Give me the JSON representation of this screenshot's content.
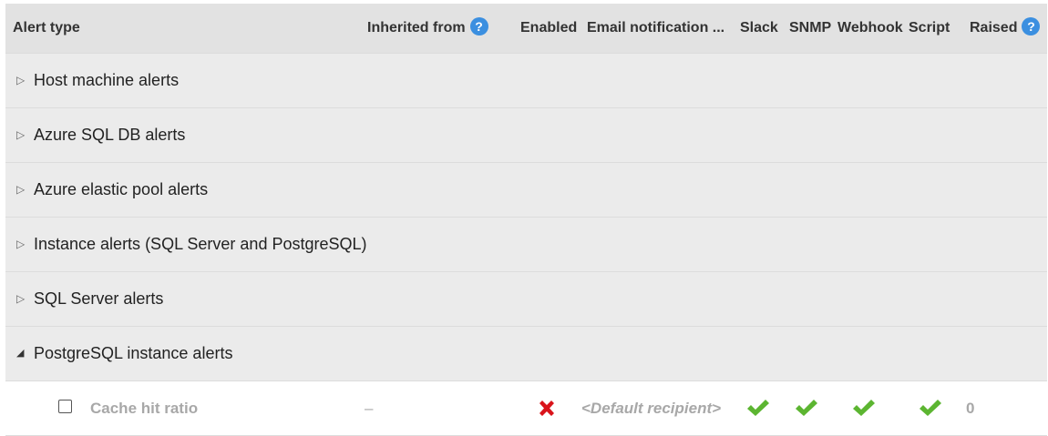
{
  "columns": {
    "alert_type": "Alert type",
    "inherited_from": "Inherited from",
    "enabled": "Enabled",
    "email": "Email notification ...",
    "slack": "Slack",
    "snmp": "SNMP",
    "webhook": "Webhook",
    "script": "Script",
    "raised": "Raised",
    "help_glyph": "?"
  },
  "groups": [
    {
      "label": "Host machine alerts",
      "expanded": false
    },
    {
      "label": "Azure SQL DB alerts",
      "expanded": false
    },
    {
      "label": "Azure elastic pool alerts",
      "expanded": false
    },
    {
      "label": "Instance alerts (SQL Server and PostgreSQL)",
      "expanded": false
    },
    {
      "label": "SQL Server alerts",
      "expanded": false
    },
    {
      "label": "PostgreSQL instance alerts",
      "expanded": true
    }
  ],
  "rows": [
    {
      "name": "Cache hit ratio",
      "inherited_from": "–",
      "enabled": false,
      "email": "<Default recipient>",
      "slack": true,
      "snmp": true,
      "webhook": true,
      "script": true,
      "raised": "0"
    }
  ],
  "colors": {
    "header_bg": "#e2e2e2",
    "group_bg": "#ebebeb",
    "help_blue": "#3b8fe0",
    "check_green": "#5cb531",
    "cross_red": "#d9141b",
    "muted_text": "#a8a8a8"
  },
  "icons": {
    "collapsed": "triangle-right-icon",
    "expanded": "triangle-down-icon",
    "enabled_state": "x-icon",
    "channel_state": "checkmark-icon"
  }
}
